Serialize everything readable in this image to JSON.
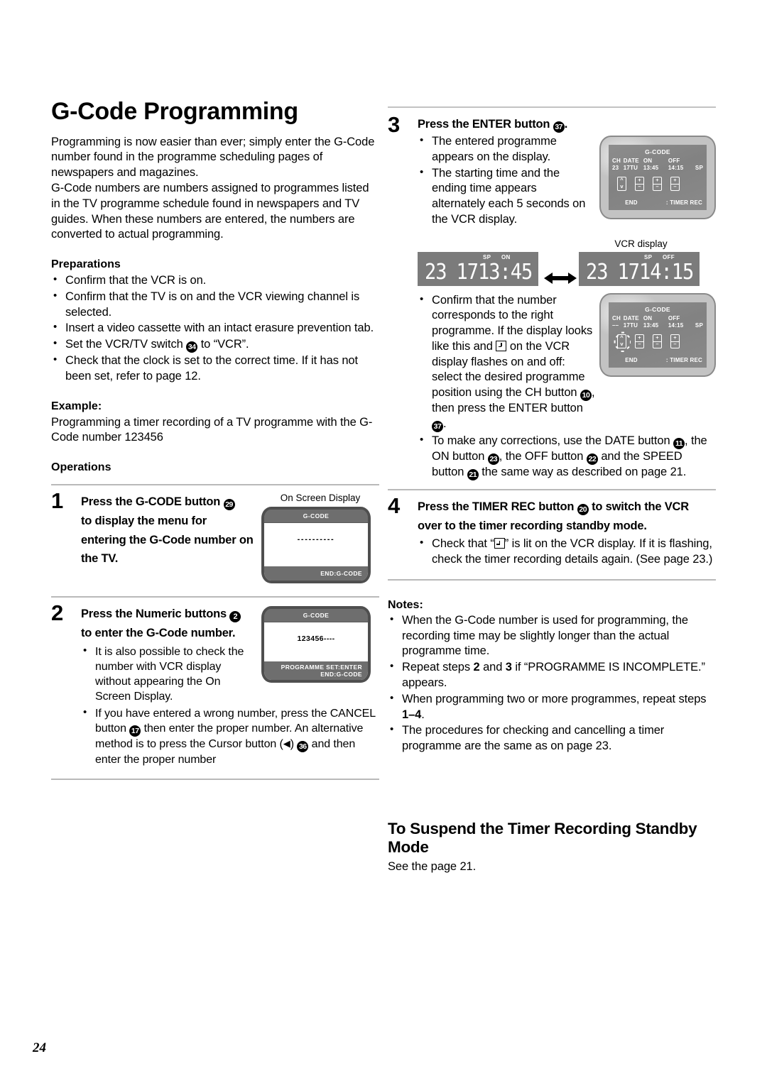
{
  "page": {
    "number": "24"
  },
  "left": {
    "title": "G-Code Programming",
    "intro": "Programming is now easier than ever; simply enter the G-Code number found in the programme scheduling pages of newspapers and magazines.\nG-Code numbers are numbers assigned to programmes listed in the TV programme schedule found in newspapers and TV guides. When these numbers are entered, the numbers are converted to actual programming.",
    "preparations_head": "Preparations",
    "preparations": [
      "Confirm that the VCR is on.",
      "Confirm that the TV is on and the VCR viewing channel is selected.",
      "Insert a video cassette with an intact erasure prevention tab."
    ],
    "prep_switch_a": "Set the VCR/TV switch",
    "prep_switch_badge": "34",
    "prep_switch_b": "to “VCR”.",
    "prep_clock": "Check that the clock is set to the correct time. If it has not been set, refer to page 12.",
    "example_head": "Example:",
    "example_text": "Programming a timer recording of a TV programme with the G-Code number 123456",
    "operations_head": "Operations",
    "step1": {
      "num": "1",
      "title_a": "Press the G-CODE button",
      "badge": "29",
      "title_b": "to display the menu for entering the G-Code number on the TV.",
      "osd_label": "On Screen Display",
      "osd": {
        "top": "G-CODE",
        "center": "----------",
        "bottom": "END:G-CODE"
      }
    },
    "step2": {
      "num": "2",
      "title_a": "Press the Numeric buttons",
      "badge": "2",
      "title_b": "to enter the G-Code number.",
      "bullets": [
        "It is also possible to check the number with VCR display without appearing the On Screen Display."
      ],
      "bullet_cancel_a": "If you have entered a wrong number, press the CANCEL button",
      "bullet_cancel_badge": "17",
      "bullet_cancel_b": "then enter the proper number. An alternative method is to press the Cursor button (",
      "bullet_cancel_c": ")",
      "bullet_cancel_badge2": "36",
      "bullet_cancel_d": "and then enter the proper number",
      "osd": {
        "top": "G-CODE",
        "center": "123456----",
        "bottom_left": "PROGRAMME SET:ENTER",
        "bottom_right": "END:G-CODE"
      }
    }
  },
  "right": {
    "step3": {
      "num": "3",
      "title_a": "Press the ENTER button",
      "badge": "37",
      "title_b": ".",
      "bullets": [
        "The entered programme appears on the display.",
        "The starting time and the ending time appears alternately each 5 seconds on the VCR display."
      ],
      "tv1": {
        "title": "G-CODE",
        "headers": [
          "CH",
          "DATE",
          "ON",
          "OFF",
          ""
        ],
        "values": [
          "23",
          "17TU",
          "13:45",
          "14:15",
          "SP"
        ],
        "foot_end": "END",
        "foot_timer": ": TIMER REC"
      },
      "tv2": {
        "title": "G-CODE",
        "headers": [
          "CH",
          "DATE",
          "ON",
          "OFF",
          ""
        ],
        "values": [
          "––",
          "17TU",
          "13:45",
          "14:15",
          "SP"
        ],
        "foot_end": "END",
        "foot_timer": ": TIMER REC"
      },
      "vcr_label": "VCR display",
      "vcr_left": {
        "mini_sp": "SP",
        "mini_state": "ON",
        "channel": "23",
        "date": "17",
        "time": "13:45"
      },
      "vcr_right": {
        "mini_sp": "SP",
        "mini_state": "OFF",
        "channel": "23",
        "date": "17",
        "time": "14:15"
      },
      "confirm_a": "Confirm that the number corresponds to the right programme. If the display looks like this and",
      "confirm_b": "on the VCR display flashes on and off: select the desired programme position using the CH button",
      "confirm_badge_ch": "10",
      "confirm_c": ", then press the ENTER button",
      "confirm_badge_enter": "37",
      "confirm_d": ".",
      "corrections_a": "To make any corrections, use the DATE button",
      "corrections_badge_date": "11",
      "corrections_b": ", the ON button",
      "corrections_badge_on": "23",
      "corrections_c": ", the OFF button",
      "corrections_badge_off": "22",
      "corrections_d": "and the SPEED button",
      "corrections_badge_speed": "21",
      "corrections_e": "the same way as described on page 21."
    },
    "step4": {
      "num": "4",
      "title_a": "Press the TIMER REC button",
      "badge": "20",
      "title_b": "to switch the VCR over to the timer recording standby mode.",
      "check_a": "Check that “",
      "check_b": "” is lit on the VCR display. If it is flashing, check the timer recording details again. (See page 23.)"
    },
    "notes_head": "Notes:",
    "notes": [
      "When the G-Code number is used for programming, the recording time may be slightly longer than the actual programme time."
    ],
    "note_repeat_a": "Repeat steps",
    "note_repeat_n1": "2",
    "note_repeat_and": "and",
    "note_repeat_n2": "3",
    "note_repeat_b": "if “PROGRAMME IS INCOMPLETE.” appears.",
    "note_multi_a": "When programming two or more programmes, repeat steps",
    "note_multi_n": "1–4",
    "note_multi_b": ".",
    "note_last": "The procedures for checking and cancelling a timer programme are the same as on page 23.",
    "suspend_head": "To Suspend the Timer Recording Standby Mode",
    "suspend_text": "See the page 21."
  }
}
